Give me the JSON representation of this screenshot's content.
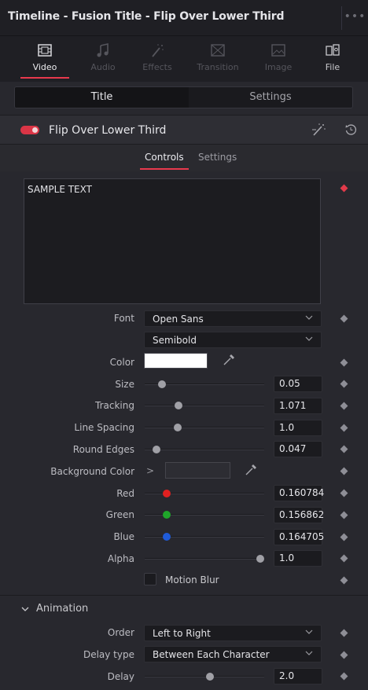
{
  "window": {
    "title": "Timeline - Fusion Title - Flip Over Lower Third",
    "more_label": "•••"
  },
  "inspector_tabs": [
    {
      "label": "Video",
      "icon": "film-icon"
    },
    {
      "label": "Audio",
      "icon": "music-note-icon"
    },
    {
      "label": "Effects",
      "icon": "magic-wand-icon"
    },
    {
      "label": "Transition",
      "icon": "transition-icon"
    },
    {
      "label": "Image",
      "icon": "image-icon"
    },
    {
      "label": "File",
      "icon": "file-icon"
    }
  ],
  "sub_tabs": {
    "title": "Title",
    "settings": "Settings"
  },
  "effect": {
    "name": "Flip Over Lower Third",
    "enabled": true
  },
  "control_tabs": {
    "controls": "Controls",
    "settings": "Settings"
  },
  "text": {
    "value": "SAMPLE TEXT"
  },
  "font": {
    "label": "Font",
    "family": "Open Sans",
    "style": "Semibold"
  },
  "color": {
    "label": "Color",
    "value": "#ffffff"
  },
  "size": {
    "label": "Size",
    "value": "0.05",
    "fraction": 0.12
  },
  "tracking": {
    "label": "Tracking",
    "value": "1.071",
    "fraction": 0.27
  },
  "line_spacing": {
    "label": "Line Spacing",
    "value": "1.0",
    "fraction": 0.26
  },
  "round_edges": {
    "label": "Round Edges",
    "value": "0.047",
    "fraction": 0.07
  },
  "background_color": {
    "label": "Background Color"
  },
  "red": {
    "label": "Red",
    "value": "0.160784",
    "fraction": 0.16,
    "color": "#e02020"
  },
  "green": {
    "label": "Green",
    "value": "0.156862",
    "fraction": 0.16,
    "color": "#1fa62a"
  },
  "blue": {
    "label": "Blue",
    "value": "0.164705",
    "fraction": 0.16,
    "color": "#1f5bd8"
  },
  "alpha": {
    "label": "Alpha",
    "value": "1.0",
    "fraction": 1.0
  },
  "motion_blur": {
    "label": "Motion Blur",
    "checked": false
  },
  "animation": {
    "title": "Animation",
    "order": {
      "label": "Order",
      "value": "Left to Right"
    },
    "delay_type": {
      "label": "Delay type",
      "value": "Between Each Character"
    },
    "delay": {
      "label": "Delay",
      "value": "2.0",
      "fraction": 0.55
    }
  },
  "colors": {
    "accent": "#e8394d",
    "panel": "#28282e"
  }
}
